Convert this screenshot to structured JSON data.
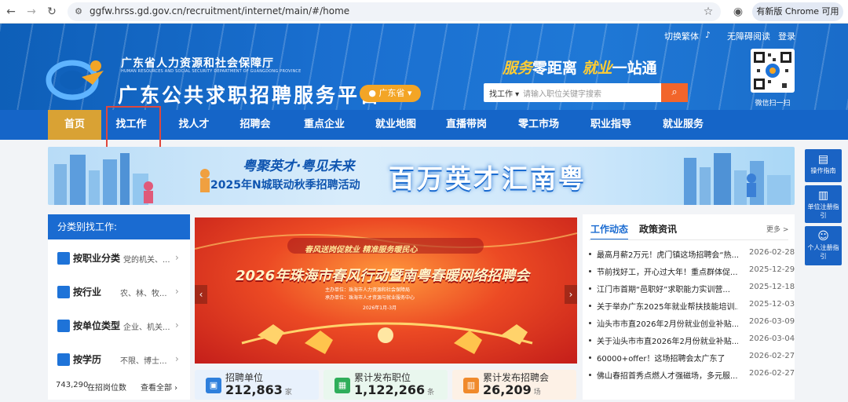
{
  "browser": {
    "url": "ggfw.hrss.gd.gov.cn/recruitment/internet/main/#/home",
    "new_version_label": "有新版 Chrome 可用"
  },
  "header": {
    "links": [
      "切换繁体",
      "无障碍阅读",
      "登录"
    ],
    "org_name_cn": "广东省人力资源和社会保障厅",
    "org_name_en": "HUMAN RESOURCES AND SOCIAL SECURITY DEPARTMENT OF GUANGDONG PROVINCE",
    "site_title": "广东公共求职招聘服务平台",
    "province_selector": "广东省",
    "slogan": {
      "part1": "服务",
      "part2": "零距离",
      "part3": "就业",
      "part4": "一站通"
    },
    "search": {
      "type": "找工作",
      "placeholder": "请输入职位关键字搜索"
    },
    "qr_caption": "微信扫一扫"
  },
  "nav": {
    "items": [
      "首页",
      "找工作",
      "找人才",
      "招聘会",
      "重点企业",
      "就业地图",
      "直播带岗",
      "零工市场",
      "职业指导",
      "就业服务"
    ]
  },
  "banner": {
    "sub1": "粤聚英才·粤见未来",
    "sub2": "2025年N城联动秋季招聘活动",
    "main": "百万英才汇南粤"
  },
  "side_tools": [
    {
      "label": "操作指南",
      "icon": "book-icon"
    },
    {
      "label": "单位注册指引",
      "icon": "building-icon"
    },
    {
      "label": "个人注册指引",
      "icon": "person-icon"
    }
  ],
  "category": {
    "title": "分类别找工作:",
    "rows": [
      {
        "title": "按职业分类",
        "desc": "党的机关、..."
      },
      {
        "title": "按行业",
        "desc": "农、林、牧..."
      },
      {
        "title": "按单位类型",
        "desc": "企业、机关..."
      },
      {
        "title": "按学历",
        "desc": "不限、博士..."
      }
    ],
    "footer_count": "743,290",
    "footer_text": "在招岗位数",
    "footer_link": "查看全部"
  },
  "carousel": {
    "sub": "春风送岗促就业  精准服务暖民心",
    "title": "2026年珠海市春风行动暨南粤春暖网络招聘会",
    "org1": "主办单位：珠海市人力资源和社会保障局",
    "org2": "承办单位：珠海市人才资源与就业服务中心",
    "date": "2026年1月-3月"
  },
  "stats": [
    {
      "label": "招聘单位",
      "value": "212,863",
      "unit": "家",
      "icon": "briefcase-icon",
      "color": "#2e7fdc",
      "bg": "#e8f1fc"
    },
    {
      "label": "累计发布职位",
      "value": "1,122,266",
      "unit": "条",
      "icon": "id-card-icon",
      "color": "#2fae5a",
      "bg": "#e9f7ee"
    },
    {
      "label": "累计发布招聘会",
      "value": "26,209",
      "unit": "场",
      "icon": "chart-icon",
      "color": "#f08a2c",
      "bg": "#fdf1e6"
    }
  ],
  "news": {
    "tabs": [
      "工作动态",
      "政策资讯"
    ],
    "more": "更多 >",
    "items": [
      {
        "title": "最高月薪2万元！虎门镇这场招聘会“热...",
        "date": "2026-02-28"
      },
      {
        "title": "节前找好工，开心过大年！重点群体促...",
        "date": "2025-12-29"
      },
      {
        "title": "江门市首期“邑职好”求职能力实训营...",
        "date": "2025-12-18"
      },
      {
        "title": "关于举办广东2025年就业帮扶技能培训...",
        "date": "2025-12-03"
      },
      {
        "title": "汕头市市直2026年2月份就业创业补贴...",
        "date": "2026-03-09"
      },
      {
        "title": "关于汕头市市直2026年2月份就业补贴...",
        "date": "2026-03-04"
      },
      {
        "title": "60000+offer！这场招聘会太广东了",
        "date": "2026-02-27"
      },
      {
        "title": "佛山春招首秀点燃人才强磁场，多元服...",
        "date": "2026-02-27"
      }
    ]
  }
}
